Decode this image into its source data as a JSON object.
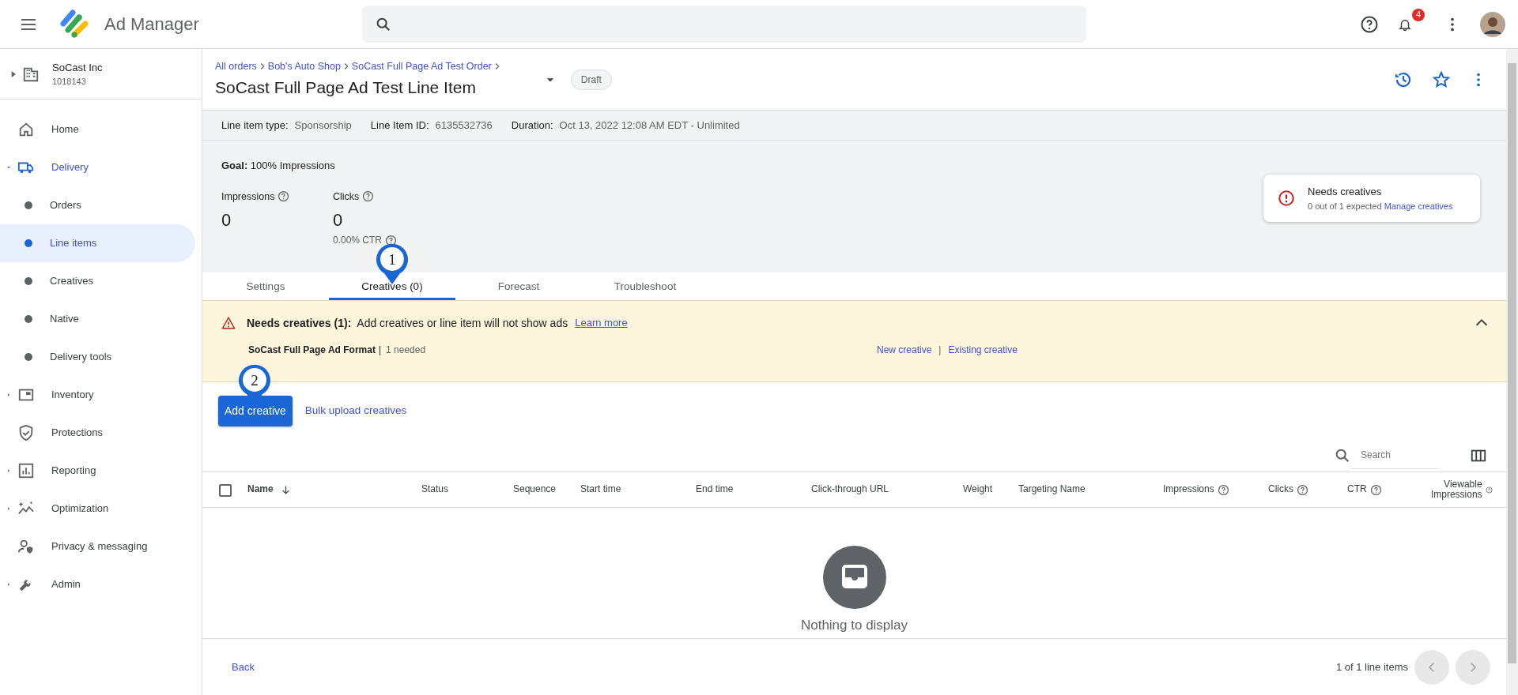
{
  "app": {
    "title": "Ad Manager",
    "notifications": "4"
  },
  "network": {
    "name": "SoCast Inc",
    "code": "1018143"
  },
  "sidebar": {
    "items": [
      {
        "label": "Home",
        "kind": "link",
        "selected": false
      },
      {
        "label": "Delivery",
        "kind": "group",
        "expanded": true,
        "selected": true,
        "children": [
          {
            "label": "Orders",
            "selected": false
          },
          {
            "label": "Line items",
            "selected": true
          },
          {
            "label": "Creatives",
            "selected": false
          },
          {
            "label": "Native",
            "selected": false
          },
          {
            "label": "Delivery tools",
            "selected": false
          }
        ]
      },
      {
        "label": "Inventory",
        "kind": "group",
        "expanded": false,
        "selected": false
      },
      {
        "label": "Protections",
        "kind": "link",
        "selected": false
      },
      {
        "label": "Reporting",
        "kind": "group",
        "expanded": false,
        "selected": false
      },
      {
        "label": "Optimization",
        "kind": "group",
        "expanded": false,
        "selected": false
      },
      {
        "label": "Privacy & messaging",
        "kind": "link",
        "selected": false
      },
      {
        "label": "Admin",
        "kind": "group",
        "expanded": false,
        "selected": false
      }
    ]
  },
  "header": {
    "breadcrumbs": [
      "All orders",
      "Bob's Auto Shop",
      "SoCast Full Page Ad Test Order"
    ],
    "title": "SoCast Full Page Ad Test Line Item",
    "status": "Draft"
  },
  "info": [
    {
      "label": "Line item type:",
      "value": "Sponsorship"
    },
    {
      "label": "Line Item ID:",
      "value": "6135532736"
    },
    {
      "label": "Duration:",
      "value": "Oct 13, 2022 12:08 AM EDT - Unlimited"
    }
  ],
  "goal": {
    "label": "Goal:",
    "value": "100% Impressions"
  },
  "stats": [
    {
      "label": "Impressions",
      "value": "0"
    },
    {
      "label": "Clicks",
      "value": "0",
      "sub": "0.00% CTR"
    }
  ],
  "alert_card": {
    "title": "Needs creatives",
    "text": "0 out of 1 expected",
    "link": "Manage creatives"
  },
  "tabs": [
    {
      "label": "Settings",
      "selected": false
    },
    {
      "label": "Creatives (0)",
      "selected": true
    },
    {
      "label": "Forecast",
      "selected": false
    },
    {
      "label": "Troubleshoot",
      "selected": false
    }
  ],
  "banner": {
    "title": "Needs creatives (1):",
    "text": "Add creatives or line item will not show ads",
    "link": "Learn more",
    "expanded": true,
    "rows": [
      {
        "format": "SoCast Full Page Ad Format",
        "separator": "|",
        "needed": "1 needed",
        "actions": [
          "New creative",
          "Existing creative"
        ],
        "divider": "|"
      }
    ]
  },
  "actions": {
    "primary": "Add creative",
    "secondary": "Bulk upload creatives"
  },
  "search": {
    "placeholder": "Search"
  },
  "table": {
    "select_all": {
      "checked": false
    },
    "columns": [
      {
        "label": "Name",
        "sorted": true,
        "help": false
      },
      {
        "label": "Status",
        "sorted": false,
        "help": false
      },
      {
        "label": "Sequence",
        "sorted": false,
        "help": false
      },
      {
        "label": "Start time",
        "sorted": false,
        "help": false
      },
      {
        "label": "End time",
        "sorted": false,
        "help": false
      },
      {
        "label": "Click-through URL",
        "sorted": false,
        "help": false
      },
      {
        "label": "Weight",
        "sorted": false,
        "help": false
      },
      {
        "label": "Targeting Name",
        "sorted": false,
        "help": false
      },
      {
        "label": "Impressions",
        "sorted": false,
        "help": true
      },
      {
        "label": "Clicks",
        "sorted": false,
        "help": true
      },
      {
        "label": "CTR",
        "sorted": false,
        "help": true
      },
      {
        "label": "Viewable Impressions",
        "sorted": false,
        "help": true
      }
    ],
    "empty": "Nothing to display"
  },
  "footer": {
    "back": "Back",
    "count": "1 of 1 line items"
  },
  "callouts": [
    {
      "label": "1"
    },
    {
      "label": "2"
    }
  ]
}
